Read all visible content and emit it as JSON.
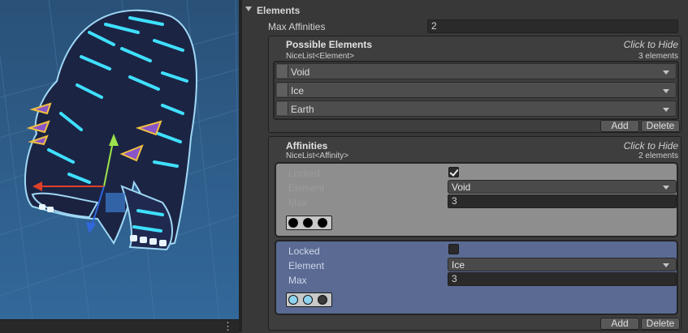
{
  "elements_section": {
    "title": "Elements",
    "max_affinities": {
      "label": "Max Affinities",
      "value": "2"
    }
  },
  "possible_elements": {
    "title": "Possible Elements",
    "subtitle": "NiceList<Element>",
    "hide_label": "Click to Hide",
    "count_label": "3 elements",
    "items": [
      {
        "label": "Void"
      },
      {
        "label": "Ice"
      },
      {
        "label": "Earth"
      }
    ],
    "add_label": "Add",
    "delete_label": "Delete"
  },
  "affinities": {
    "title": "Affinities",
    "subtitle": "NiceList<Affinity>",
    "hide_label": "Click to Hide",
    "count_label": "2 elements",
    "items": [
      {
        "locked_label": "Locked",
        "locked": true,
        "element_label": "Element",
        "element": "Void",
        "max_label": "Max",
        "max": "3",
        "swatches": [
          "#000000",
          "#000000",
          "#000000"
        ]
      },
      {
        "locked_label": "Locked",
        "locked": false,
        "element_label": "Element",
        "element": "Ice",
        "max_label": "Max",
        "max": "3",
        "swatches": [
          "#8fd3f0",
          "#8fd3f0",
          "#3a3a3a"
        ]
      }
    ],
    "add_label": "Add",
    "delete_label": "Delete"
  },
  "scene_menu_icon": "vertical-ellipsis-icon",
  "colors": {
    "selected_card": "#5a6a93",
    "unselected_card": "#8e8e8e",
    "inspector_bg": "#383838",
    "scene_bg": "#2d5c86"
  }
}
